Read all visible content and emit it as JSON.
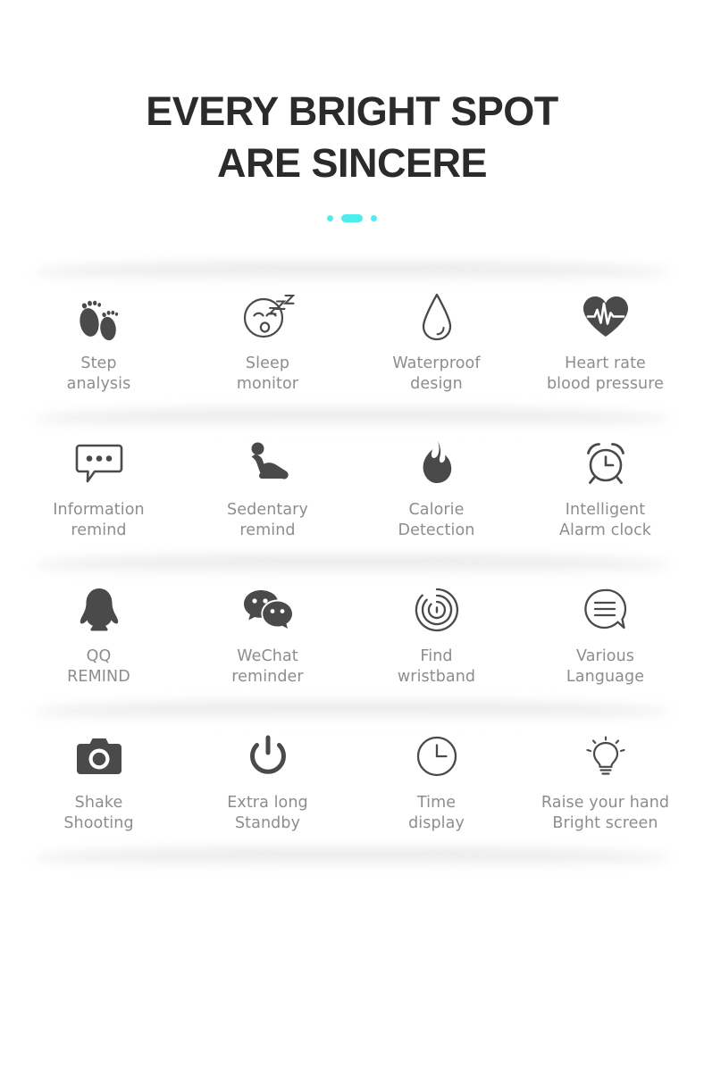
{
  "header": {
    "headline_line1": "EVERY BRIGHT SPOT",
    "headline_line2": "ARE SINCERE",
    "accent_color": "#4ceded"
  },
  "theme": {
    "background": "#ffffff",
    "heading_color": "#2b2b2b",
    "label_color": "#8d8d8d",
    "icon_color": "#4a4a4a",
    "shadow_color": "#e4e4e6"
  },
  "features": {
    "rows": [
      {
        "cells": [
          {
            "icon": "footprints-icon",
            "label": "Step\nanalysis"
          },
          {
            "icon": "sleeping-face-icon",
            "label": "Sleep\nmonitor"
          },
          {
            "icon": "water-drop-icon",
            "label": "Waterproof\ndesign"
          },
          {
            "icon": "heart-pulse-icon",
            "label": "Heart rate\nblood pressure"
          }
        ]
      },
      {
        "cells": [
          {
            "icon": "speech-bubble-dots-icon",
            "label": "Information\nremind"
          },
          {
            "icon": "seated-person-icon",
            "label": "Sedentary\nremind"
          },
          {
            "icon": "flame-icon",
            "label": "Calorie\nDetection"
          },
          {
            "icon": "alarm-clock-icon",
            "label": "Intelligent\nAlarm clock"
          }
        ]
      },
      {
        "cells": [
          {
            "icon": "qq-penguin-icon",
            "label": "QQ\nREMIND"
          },
          {
            "icon": "wechat-bubbles-icon",
            "label": "WeChat\nreminder"
          },
          {
            "icon": "radar-rings-icon",
            "label": "Find\nwristband"
          },
          {
            "icon": "speech-bubble-lines-icon",
            "label": "Various\nLanguage"
          }
        ]
      },
      {
        "cells": [
          {
            "icon": "camera-icon",
            "label": "Shake\nShooting"
          },
          {
            "icon": "power-button-icon",
            "label": "Extra long\nStandby"
          },
          {
            "icon": "clock-icon",
            "label": "Time\ndisplay"
          },
          {
            "icon": "lightbulb-icon",
            "label": "Raise your hand\nBright screen"
          }
        ]
      }
    ]
  }
}
